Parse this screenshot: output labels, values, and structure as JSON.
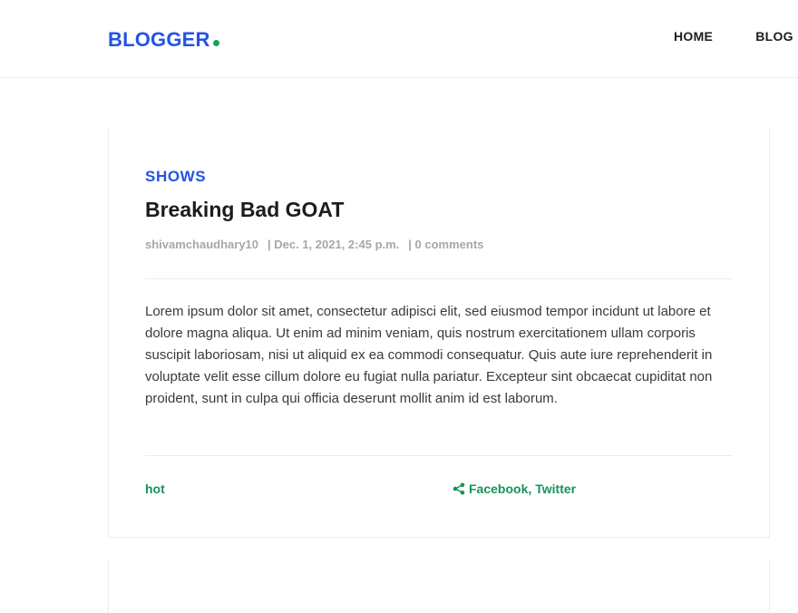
{
  "header": {
    "logo": "BLOGGER",
    "nav": [
      "HOME",
      "BLOG"
    ]
  },
  "post": {
    "category": "SHOWS",
    "title": "Breaking Bad GOAT",
    "author": "shivamchaudhary10",
    "date": "| Dec. 1, 2021, 2:45 p.m.",
    "comments": "| 0 comments",
    "body": "Lorem ipsum dolor sit amet, consectetur adipisci elit, sed eiusmod tempor incidunt ut labore et dolore magna aliqua. Ut enim ad minim veniam, quis nostrum exercitationem ullam corporis suscipit laboriosam, nisi ut aliquid ex ea commodi consequatur. Quis aute iure reprehenderit in voluptate velit esse cillum dolore eu fugiat nulla pariatur. Excepteur sint obcaecat cupiditat non proident, sunt in culpa qui officia deserunt mollit anim id est laborum.",
    "tag": "hot",
    "share_facebook": "Facebook",
    "share_sep": ",",
    "share_twitter": "Twitter"
  },
  "colors": {
    "brand": "#2553e3",
    "accent": "#17a35f",
    "share": "#17935a"
  },
  "icons": {
    "logo_dot": "dot-icon",
    "share": "share-icon"
  }
}
